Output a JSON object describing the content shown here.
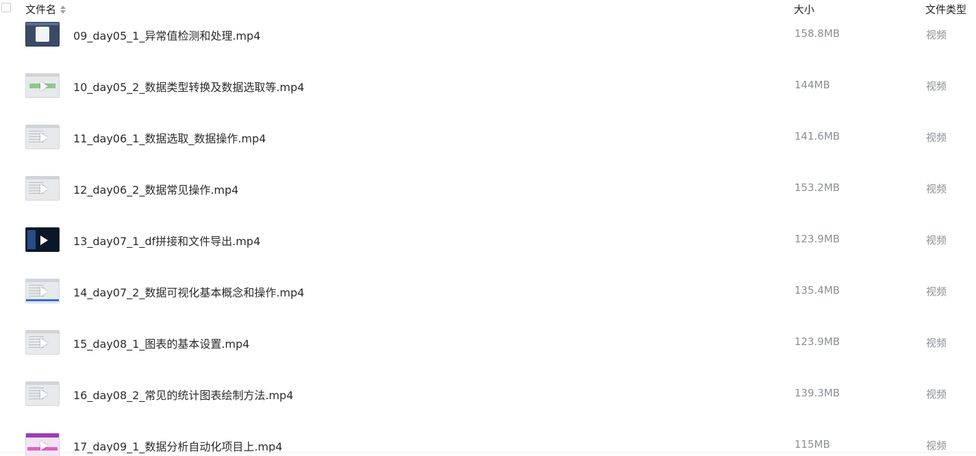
{
  "header": {
    "name_label": "文件名",
    "size_label": "大小",
    "type_label": "文件类型"
  },
  "files": [
    {
      "name": "09_day05_1_异常值检测和处理.mp4",
      "size": "158.8MB",
      "type": "视频",
      "thumb": "dark"
    },
    {
      "name": "10_day05_2_数据类型转换及数据选取等.mp4",
      "size": "144MB",
      "type": "视频",
      "thumb": "greenstrip"
    },
    {
      "name": "11_day06_1_数据选取_数据操作.mp4",
      "size": "141.6MB",
      "type": "视频",
      "thumb": "light"
    },
    {
      "name": "12_day06_2_数据常见操作.mp4",
      "size": "153.2MB",
      "type": "视频",
      "thumb": "light"
    },
    {
      "name": "13_day07_1_df拼接和文件导出.mp4",
      "size": "123.9MB",
      "type": "视频",
      "thumb": "black"
    },
    {
      "name": "14_day07_2_数据可视化基本概念和操作.mp4",
      "size": "135.4MB",
      "type": "视频",
      "thumb": "blueline"
    },
    {
      "name": "15_day08_1_图表的基本设置.mp4",
      "size": "123.9MB",
      "type": "视频",
      "thumb": "light"
    },
    {
      "name": "16_day08_2_常见的统计图表绘制方法.mp4",
      "size": "139.3MB",
      "type": "视频",
      "thumb": "light"
    },
    {
      "name": "17_day09_1_数据分析自动化项目上.mp4",
      "size": "115MB",
      "type": "视频",
      "thumb": "pink"
    }
  ]
}
